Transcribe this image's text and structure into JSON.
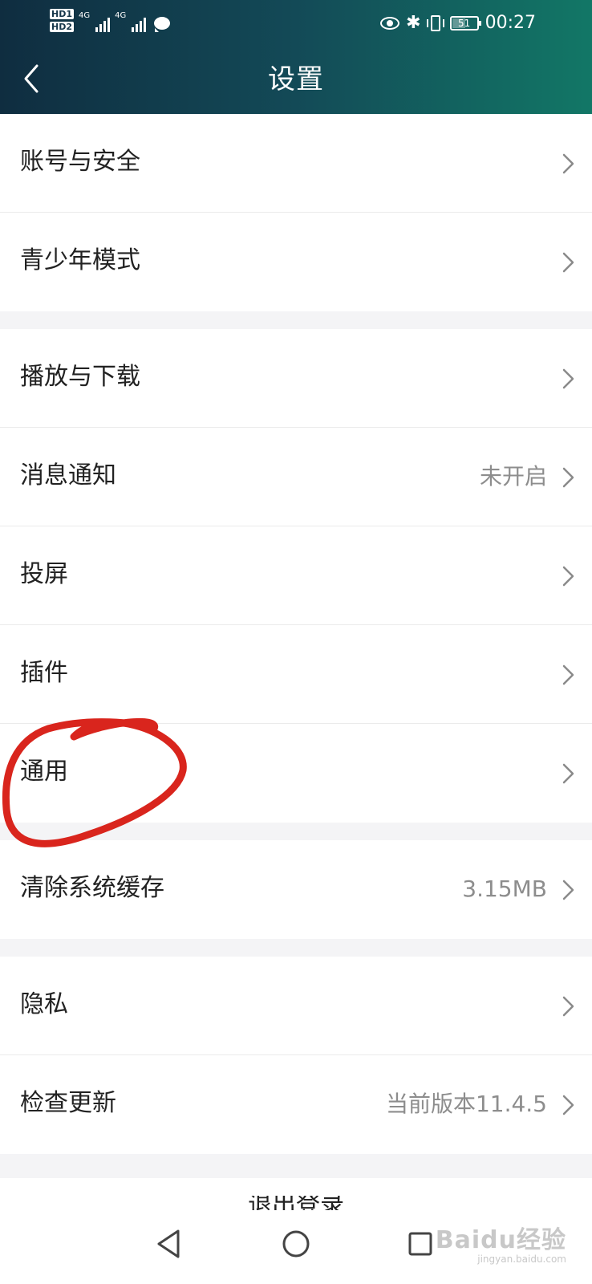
{
  "status_bar": {
    "hd_badges": [
      "HD1",
      "HD2"
    ],
    "network_labels": [
      "4G",
      "4G"
    ],
    "battery_level": 51,
    "battery_text": "51",
    "clock": "00:27"
  },
  "header": {
    "title": "设置",
    "back_icon": "chevron-left-icon"
  },
  "sections": [
    {
      "items": [
        {
          "label": "账号与安全",
          "value": ""
        },
        {
          "label": "青少年模式",
          "value": ""
        }
      ]
    },
    {
      "items": [
        {
          "label": "播放与下载",
          "value": ""
        },
        {
          "label": "消息通知",
          "value": "未开启"
        },
        {
          "label": "投屏",
          "value": ""
        },
        {
          "label": "插件",
          "value": ""
        },
        {
          "label": "通用",
          "value": ""
        }
      ]
    },
    {
      "items": [
        {
          "label": "清除系统缓存",
          "value": "3.15MB"
        }
      ]
    },
    {
      "items": [
        {
          "label": "隐私",
          "value": ""
        },
        {
          "label": "检查更新",
          "value": "当前版本11.4.5"
        }
      ]
    }
  ],
  "logout": {
    "label": "退出登录"
  },
  "nav_bar": {
    "icons": [
      "triangle-back-icon",
      "circle-home-icon",
      "square-recent-icon"
    ]
  },
  "annotation": {
    "shape": "hand-drawn circle",
    "color": "#d9251d",
    "target": "通用"
  },
  "watermark": {
    "brand": "Baidu经验",
    "site": "jingyan.baidu.com"
  },
  "colors": {
    "header_gradient": [
      "#0f2d40",
      "#127766"
    ],
    "background": "#f4f4f6",
    "secondary_text": "#8d8d8d"
  }
}
